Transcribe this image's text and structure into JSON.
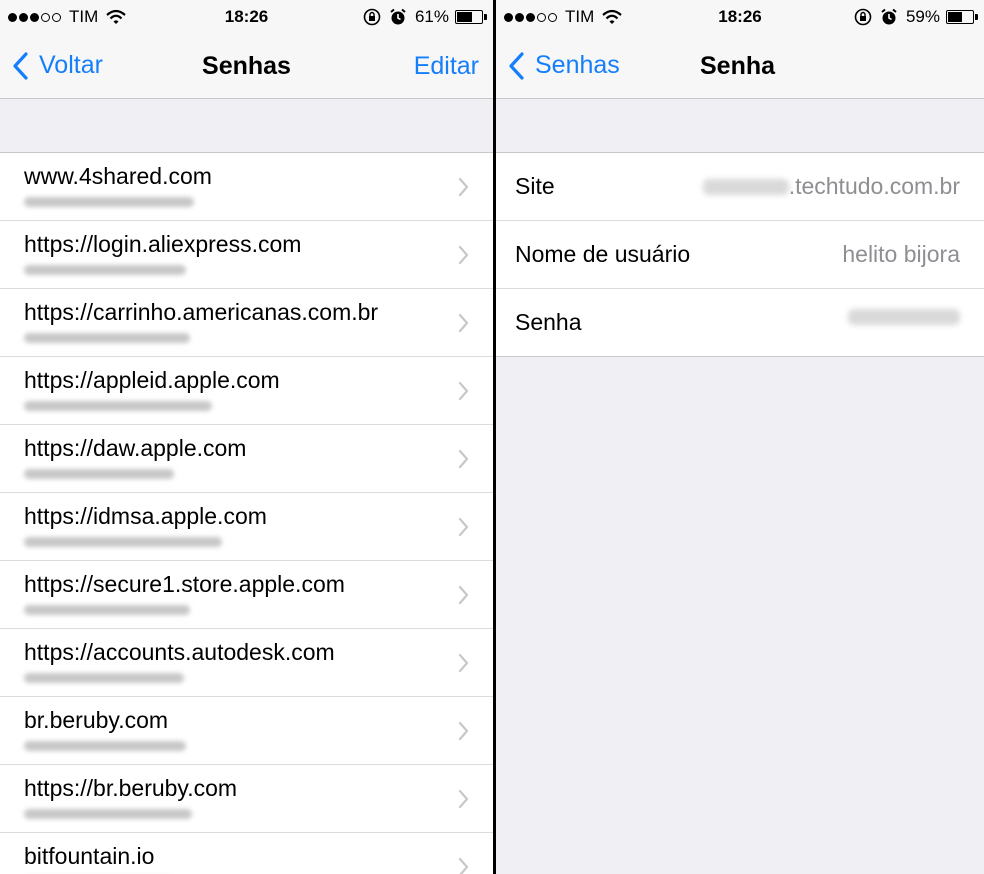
{
  "left": {
    "status": {
      "carrier": "TIM",
      "time": "18:26",
      "battery": "61%",
      "battery_level": 0.61
    },
    "nav": {
      "back_label": "Voltar",
      "title": "Senhas",
      "action_label": "Editar"
    },
    "entries": [
      {
        "site": "www.4shared.com"
      },
      {
        "site": "https://login.aliexpress.com"
      },
      {
        "site": "https://carrinho.americanas.com.br"
      },
      {
        "site": "https://appleid.apple.com"
      },
      {
        "site": "https://daw.apple.com"
      },
      {
        "site": "https://idmsa.apple.com"
      },
      {
        "site": "https://secure1.store.apple.com"
      },
      {
        "site": "https://accounts.autodesk.com"
      },
      {
        "site": "br.beruby.com"
      },
      {
        "site": "https://br.beruby.com"
      },
      {
        "site": "bitfountain.io"
      }
    ]
  },
  "right": {
    "status": {
      "carrier": "TIM",
      "time": "18:26",
      "battery": "59%",
      "battery_level": 0.59
    },
    "nav": {
      "back_label": "Senhas",
      "title": "Senha"
    },
    "fields": {
      "site_label": "Site",
      "site_value": ".techtudo.com.br",
      "user_label": "Nome de usuário",
      "user_value": "helito bijora",
      "password_label": "Senha"
    }
  }
}
